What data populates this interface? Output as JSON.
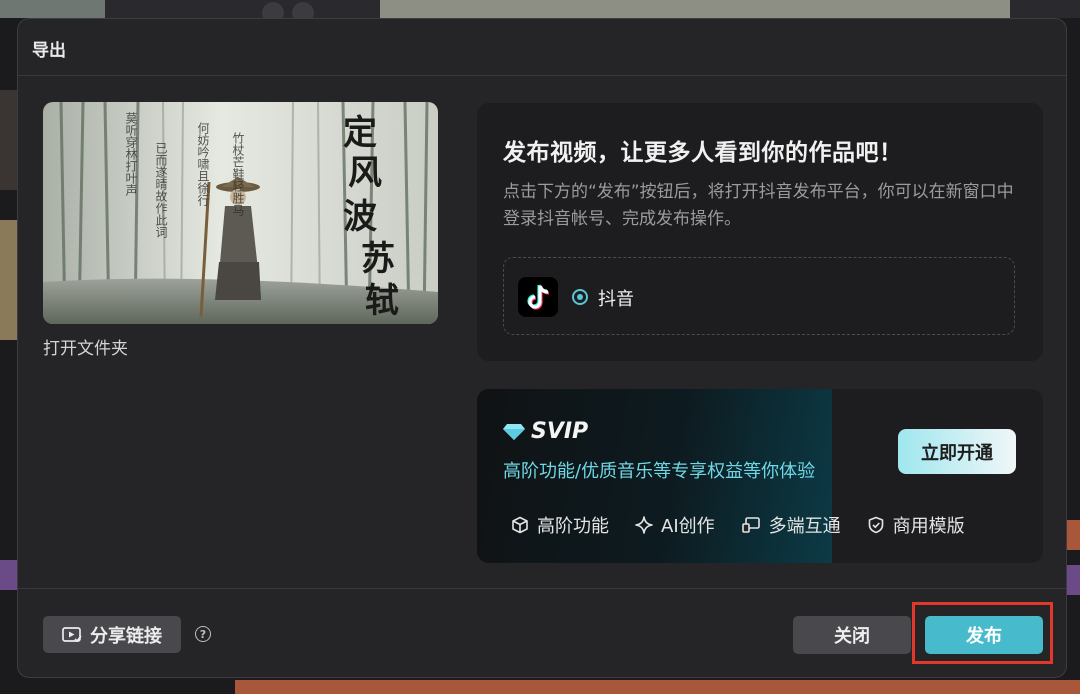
{
  "dialog": {
    "title": "导出",
    "open_folder_label": "打开文件夹"
  },
  "preview": {
    "calligraphy_title": "定风波苏轼",
    "poem_lines": [
      "莫听穿林打叶声",
      "何妨吟啸且徐行",
      "竹杖芒鞋轻胜马",
      "谁怕",
      "已而遂晴",
      "故作此词"
    ]
  },
  "publish": {
    "title": "发布视频，让更多人看到你的作品吧！",
    "description": "点击下方的“发布”按钮后，将打开抖音发布平台，你可以在新窗口中登录抖音帐号、完成发布操作。",
    "platform_label": "抖音",
    "platform_selected": true,
    "platform_icon": "tiktok-icon"
  },
  "svip": {
    "badge": "SVIP",
    "subtitle": "高阶功能/优质音乐等专享权益等你体验",
    "open_button": "立即开通",
    "features": [
      {
        "label": "高阶功能",
        "icon": "cube-icon"
      },
      {
        "label": "AI创作",
        "icon": "sparkle-icon"
      },
      {
        "label": "多端互通",
        "icon": "devices-icon"
      },
      {
        "label": "商用模版",
        "icon": "shield-check-icon"
      }
    ]
  },
  "footer": {
    "share_label": "分享链接",
    "help_symbol": "?",
    "close_label": "关闭",
    "publish_label": "发布"
  },
  "colors": {
    "accent": "#47bacb",
    "svip_text": "#6fd8e6",
    "highlight": "#e0392b"
  }
}
